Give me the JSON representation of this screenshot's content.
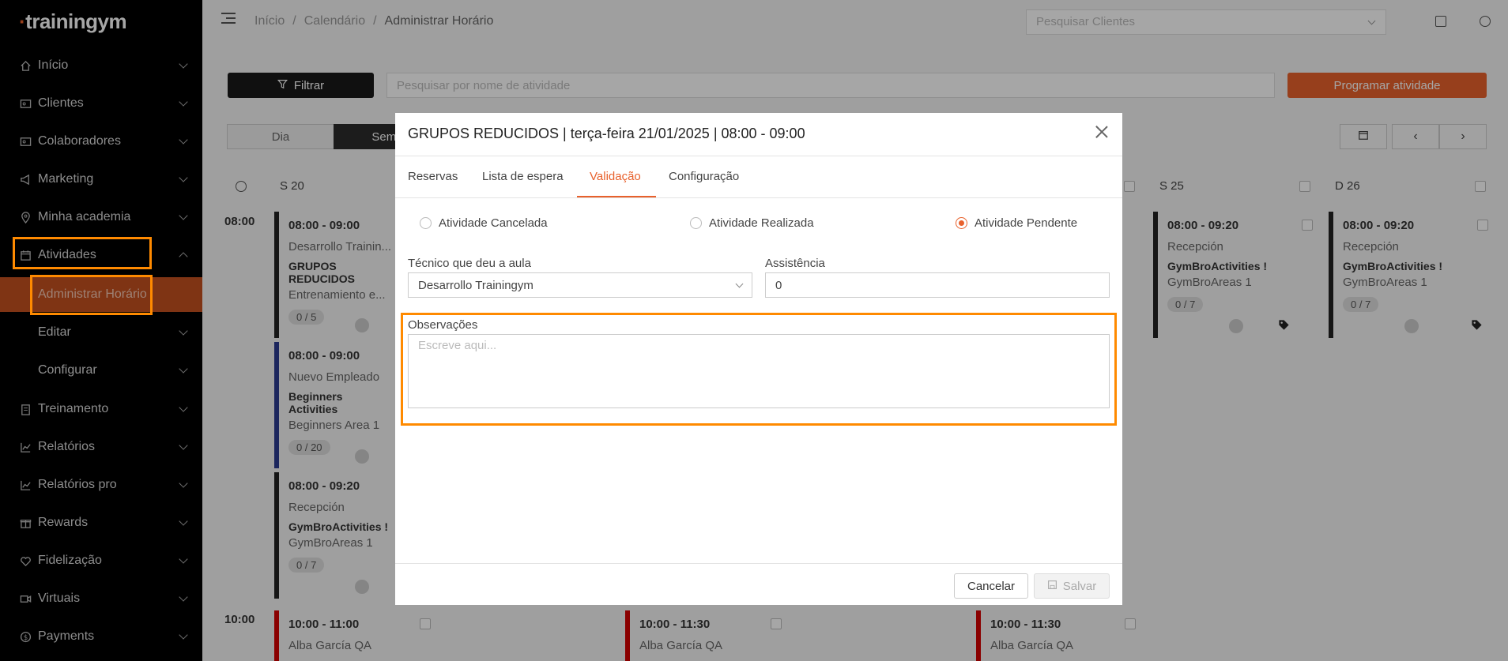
{
  "app": {
    "logo": "trainingym"
  },
  "sidebar": {
    "items": [
      {
        "label": "Início",
        "icon": "home-icon"
      },
      {
        "label": "Clientes",
        "icon": "id-card-icon"
      },
      {
        "label": "Colaboradores",
        "icon": "id-card-icon"
      },
      {
        "label": "Marketing",
        "icon": "megaphone-icon"
      },
      {
        "label": "Minha academia",
        "icon": "location-pin-icon"
      },
      {
        "label": "Atividades",
        "icon": "calendar-icon"
      },
      {
        "label": "Treinamento",
        "icon": "clipboard-icon"
      },
      {
        "label": "Relatórios",
        "icon": "chart-icon"
      },
      {
        "label": "Relatórios pro",
        "icon": "chart-icon"
      },
      {
        "label": "Rewards",
        "icon": "gift-icon"
      },
      {
        "label": "Fidelização",
        "icon": "heart-icon"
      },
      {
        "label": "Virtuais",
        "icon": "video-icon"
      },
      {
        "label": "Payments",
        "icon": "dollar-icon"
      }
    ],
    "subitems": [
      {
        "label": "Administrar Horário"
      },
      {
        "label": "Editar"
      },
      {
        "label": "Configurar"
      }
    ]
  },
  "topbar": {
    "breadcrumb": [
      "Início",
      "Calendário",
      "Administrar Horário"
    ],
    "client_search_placeholder": "Pesquisar Clientes"
  },
  "toolbar": {
    "filter_label": "Filtrar",
    "search_placeholder": "Pesquisar por nome de atividade",
    "program_label": "Programar atividade",
    "view_tabs": [
      "Dia",
      "Sema"
    ]
  },
  "calendar": {
    "days": [
      "S 20",
      "S 25",
      "D 26"
    ],
    "times": [
      "08:00",
      "10:00"
    ],
    "cards": [
      {
        "time": "08:00 - 09:00",
        "instructor": "Desarrollo Trainin...",
        "name": "GRUPOS REDUCIDOS",
        "room": "Entrenamiento e...",
        "capacity": "0 / 5"
      },
      {
        "time": "08:00 - 09:00",
        "instructor": "Nuevo Empleado",
        "name": "Beginners Activities",
        "room": "Beginners Area 1",
        "capacity": "0 / 20"
      },
      {
        "time": "08:00 - 09:20",
        "instructor": "Recepción",
        "name": "GymBroActivities !",
        "room": "GymBroAreas 1",
        "capacity": "0 / 7"
      },
      {
        "time": "08:00 - 09:20",
        "instructor": "Recepción",
        "name": "GymBroActivities !",
        "room": "GymBroAreas 1",
        "capacity": "0 / 7"
      },
      {
        "time": "08:00 - 09:20",
        "instructor": "Recepción",
        "name": "GymBroActivities !",
        "room": "GymBroAreas 1",
        "capacity": "0 / 7"
      },
      {
        "time": "10:00 - 11:00",
        "instructor": "Alba García QA"
      },
      {
        "time": "10:00 - 11:30",
        "instructor": "Alba García QA"
      },
      {
        "time": "10:00 - 11:30",
        "instructor": "Alba García QA"
      }
    ]
  },
  "modal": {
    "title": "GRUPOS REDUCIDOS | terça-feira 21/01/2025 | 08:00 - 09:00",
    "tabs": [
      "Reservas",
      "Lista de espera",
      "Validação",
      "Configuração"
    ],
    "active_tab": "Validação",
    "status_options": [
      "Atividade Cancelada",
      "Atividade Realizada",
      "Atividade Pendente"
    ],
    "selected_status": "Atividade Pendente",
    "technician_label": "Técnico que deu a aula",
    "technician_value": "Desarrollo Trainingym",
    "attendance_label": "Assistência",
    "attendance_value": "0",
    "notes_label": "Observações",
    "notes_placeholder": "Escreve aqui...",
    "cancel_label": "Cancelar",
    "save_label": "Salvar"
  },
  "colors": {
    "accent": "#e8612c",
    "highlight": "#ff8a00",
    "sidebar_bg": "#000000"
  }
}
